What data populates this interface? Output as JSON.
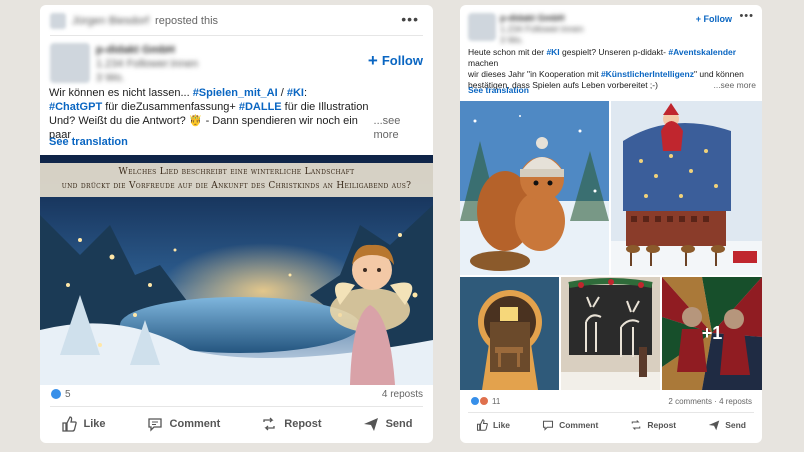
{
  "left_post": {
    "repost_header": {
      "reposter_name": "Jürgen Biesdorf",
      "action_text": "reposted this"
    },
    "author": {
      "name": "p-didakt GmbH",
      "subtitle_line1": "1.234 Follower:innen",
      "subtitle_line2": "3 Wo."
    },
    "follow_label": "Follow",
    "text": {
      "line1_plain": "Wir können es nicht lassen... ",
      "hashtag1": "#Spielen_mit_AI",
      "sep1": " / ",
      "hashtag2": "#KI",
      "colon": ":",
      "hashtag3": "#ChatGPT",
      "line2_plain": " für dieZusammenfassung+ ",
      "hashtag4": "#DALLE",
      "line2_end": " für die Illustration",
      "line3": "Und? Weißt du die Antwort? 🤴 - Dann spendieren wir noch ein paar",
      "see_more": "...see more"
    },
    "see_translation": "See translation",
    "image_caption_line1": "Welches Lied beschreibt eine winterliche Landschaft",
    "image_caption_line2": "und drückt die Vorfreude auf die Ankunft des Christkinds an Heiligabend aus?",
    "reaction_count": "5",
    "reposts": "4 reposts",
    "actions": {
      "like": "Like",
      "comment": "Comment",
      "repost": "Repost",
      "send": "Send"
    }
  },
  "right_post": {
    "author": {
      "name": "p-didakt GmbH",
      "subtitle_line1": "1.234 Follower:innen",
      "subtitle_line2": "3 Wo."
    },
    "follow_label": "+ Follow",
    "text": {
      "p1": "Heute schon mit der ",
      "h1": "#KI",
      "p2": " gespielt? Unseren p-didakt- ",
      "h2": "#Aventskalender",
      "p3": " machen",
      "p4": "wir dieses Jahr \"in Kooperation mit ",
      "h3": "#KünstlicherIntelligenz",
      "p5": "\" und können",
      "p6": "bestätigen, dass Spielen aufs Leben vorbereitet ;-)",
      "see_more": "...see more"
    },
    "see_translation": "See translation",
    "more_images": "+1",
    "reaction_count": "11",
    "stats_right": "2 comments · 4 reposts",
    "actions": {
      "like": "Like",
      "comment": "Comment",
      "repost": "Repost",
      "send": "Send"
    }
  },
  "colors": {
    "link": "#0a66c2",
    "background": "#e7e4df"
  },
  "icons": [
    "ellipsis-icon",
    "plus-icon",
    "like-icon",
    "comment-icon",
    "repost-icon",
    "send-icon"
  ]
}
